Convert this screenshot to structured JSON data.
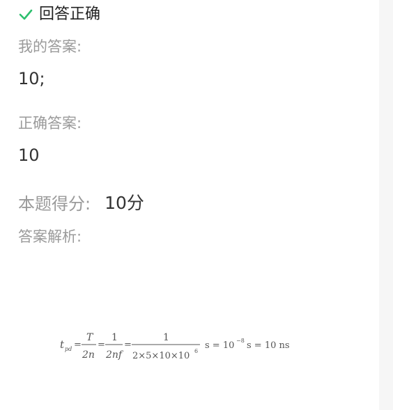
{
  "result": {
    "icon": "check-icon",
    "icon_color": "#2dbf6e",
    "text": "回答正确"
  },
  "my_answer": {
    "label": "我的答案:",
    "value": "10;"
  },
  "correct_answer": {
    "label": "正确答案:",
    "value": "10"
  },
  "score": {
    "label": "本题得分:",
    "value": "10分"
  },
  "analysis": {
    "label": "答案解析:",
    "formula": {
      "lhs": "t",
      "lhs_sub": "pd",
      "f1_num": "T",
      "f1_den": "2n",
      "f2_num": "1",
      "f2_den": "2nf",
      "f3_num": "1",
      "f3_den": "2×5×10×10",
      "f3_den_exp": "6",
      "r1_prefix": "s = 10",
      "r1_exp": "−8",
      "r2": "s = 10  ns"
    }
  }
}
